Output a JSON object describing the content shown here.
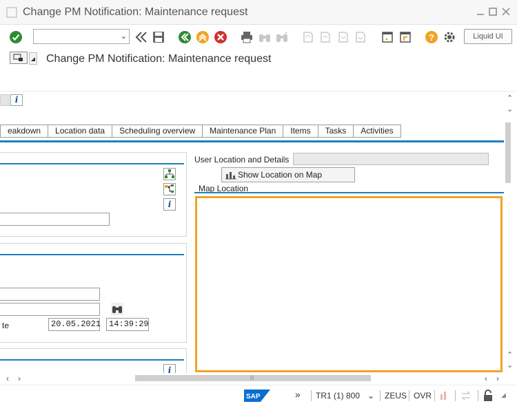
{
  "window": {
    "title": "Change PM Notification: Maintenance request",
    "minimize_icon": "minimize-icon",
    "maximize_icon": "maximize-icon",
    "close_icon": "close-icon"
  },
  "toolbar": {
    "command_field_value": "",
    "liquid_ui_label": "Liquid UI"
  },
  "header": {
    "page_title": "Change PM Notification: Maintenance request"
  },
  "tabs": [
    {
      "label": "eakdown"
    },
    {
      "label": "Location data"
    },
    {
      "label": "Scheduling overview"
    },
    {
      "label": "Maintenance Plan"
    },
    {
      "label": "Items"
    },
    {
      "label": "Tasks"
    },
    {
      "label": "Activities"
    }
  ],
  "reference_panel": {
    "date_label_fragment": "te",
    "date_value": "20.05.2021",
    "time_value": "14:39:29"
  },
  "location_panel": {
    "user_location_label": "User Location and Details",
    "user_location_value": "",
    "show_map_button": "Show Location on Map",
    "map_location_title": "Map Location"
  },
  "statusbar": {
    "system": "TR1 (1) 800",
    "server": "ZEUS",
    "mode": "OVR"
  },
  "colors": {
    "accent_blue": "#1a7fc1",
    "map_border": "#f0a324",
    "sap_blue": "#0a6ed1"
  }
}
